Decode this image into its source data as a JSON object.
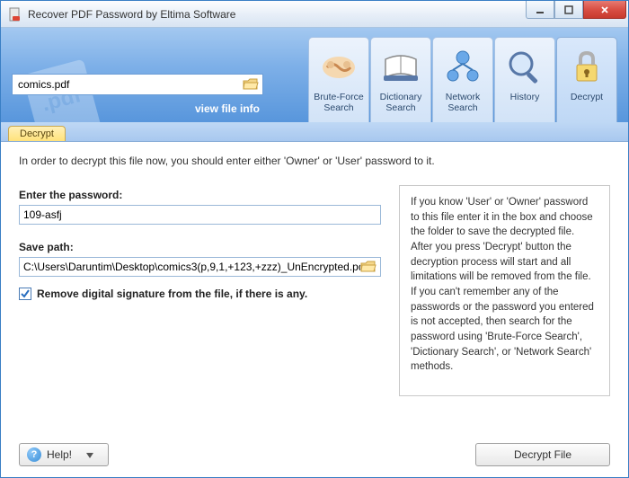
{
  "window": {
    "title": "Recover PDF Password by Eltima Software"
  },
  "file": {
    "name": "comics.pdf",
    "view_info": "view file info"
  },
  "tabs": [
    {
      "id": "brute",
      "label": "Brute-Force\nSearch",
      "icon": "handshake"
    },
    {
      "id": "dict",
      "label": "Dictionary\nSearch",
      "icon": "book"
    },
    {
      "id": "net",
      "label": "Network\nSearch",
      "icon": "network"
    },
    {
      "id": "hist",
      "label": "History",
      "icon": "magnifier"
    },
    {
      "id": "decrypt",
      "label": "Decrypt",
      "icon": "lock",
      "active": true
    }
  ],
  "subtab": {
    "label": "Decrypt"
  },
  "content": {
    "intro": "In order to decrypt this file now, you should enter either 'Owner' or 'User' password to it.",
    "password_label": "Enter the password:",
    "password_value": "109-asfj",
    "savepath_label": "Save path:",
    "savepath_value": "C:\\Users\\Daruntim\\Desktop\\comics3(p,9,1,+123,+zzz)_UnEncrypted.pdf",
    "checkbox_label": "Remove digital signature from the file, if there is any.",
    "checkbox_checked": true,
    "info_text": "If you know 'User' or 'Owner' password to this file enter it in the box and choose the folder to save the decrypted file. After you press 'Decrypt' button the decryption process will start and all limitations will be removed from the file. If you can't remember any of the passwords or the password you entered is not accepted, then search for the password using 'Brute-Force Search', 'Dictionary Search', or 'Network Search' methods."
  },
  "footer": {
    "help": "Help!",
    "decrypt": "Decrypt File"
  }
}
